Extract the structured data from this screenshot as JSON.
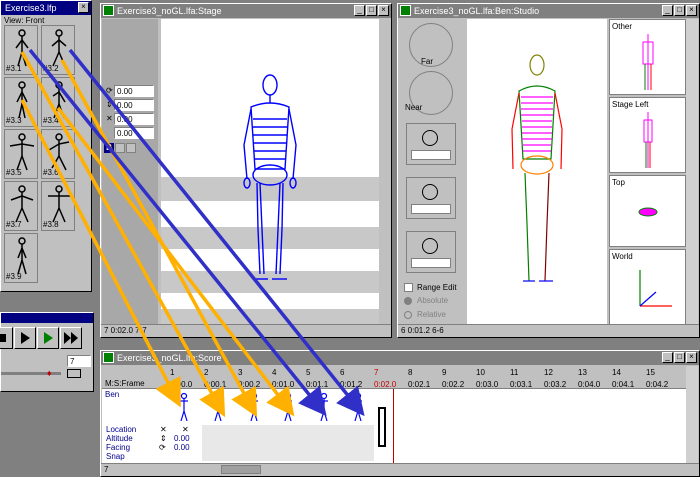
{
  "library": {
    "title": "Exercise3.lfp",
    "view_label": "View: Front",
    "thumbnails": [
      "#3.1",
      "#3.2",
      "#3.3",
      "#3.4",
      "#3.5",
      "#3.6",
      "#3.7",
      "#3.8",
      "#3.9"
    ]
  },
  "stage": {
    "title": "Exercise3_noGL.lfa:Stage",
    "fields": [
      "0.00",
      "0.00",
      "0.00",
      "0.00"
    ],
    "b_button": "B",
    "status": "7 0:02.0 7-7"
  },
  "studio": {
    "title": "Exercise3_noGL.lfa:Ben:Studio",
    "far_label": "Far",
    "near_label": "Near",
    "range_edit_label": "Range Edit",
    "absolute_label": "Absolute",
    "relative_label": "Relative",
    "views": [
      "Other",
      "Stage Left",
      "Top",
      "World"
    ],
    "status": "6 0:01.2 6-6"
  },
  "playback": {
    "frame_value": "7"
  },
  "score": {
    "title": "Exercise3_noGL.lfa:Score",
    "header_label": "M:S:Frame",
    "ticks": [
      "1",
      "2",
      "3",
      "4",
      "5",
      "6",
      "7",
      "8",
      "9",
      "10",
      "11",
      "12",
      "13",
      "14",
      "15"
    ],
    "frames": [
      "0:00.0",
      "0:00.1",
      "0:00.2",
      "0:01.0",
      "0:01.1",
      "0:01.2",
      "0:02.0",
      "0:02.1",
      "0:02.2",
      "0:03.0",
      "0:03.1",
      "0:03.2",
      "0:04.0",
      "0:04.1",
      "0:04.2"
    ],
    "current_tick": "7",
    "current_frame": "0:02.0",
    "track_name": "Ben",
    "rows": [
      {
        "label": "Location",
        "symbol": "✕",
        "value": "✕"
      },
      {
        "label": "Altitude",
        "symbol": "⇕",
        "value": "0.00"
      },
      {
        "label": "Facing",
        "symbol": "⟳",
        "value": "0.00"
      },
      {
        "label": "Snap",
        "symbol": "",
        "value": ""
      }
    ],
    "status": "7"
  },
  "colors": {
    "figure_blue": "#0000ff",
    "arrow_yellow": "#ffb000",
    "arrow_blue": "#3030c8",
    "title_active": "#000080",
    "playhead": "#c00000"
  }
}
